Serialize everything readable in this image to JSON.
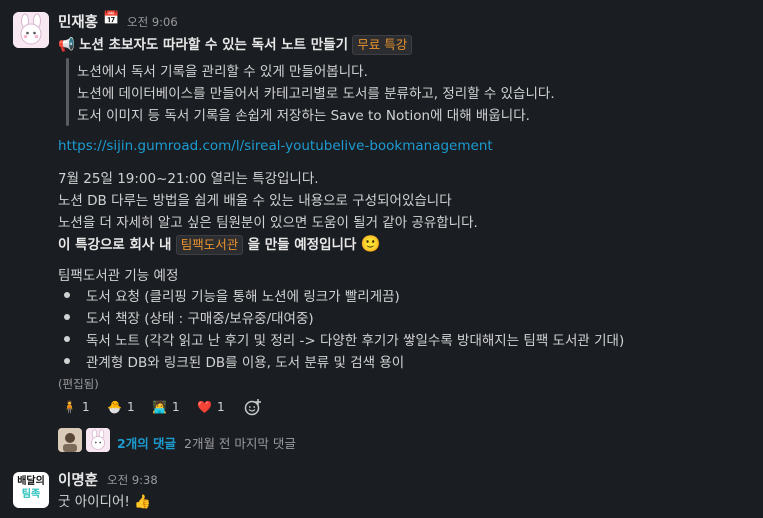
{
  "message1": {
    "author": "민재홍",
    "status_emoji": "📅",
    "time": "오전 9:06",
    "headline_emoji": "📢",
    "headline": "노션 초보자도 따라할 수 있는 독서 노트 만들기",
    "headline_tag": "무료 특강",
    "quote_lines": [
      "노션에서 독서 기록을 관리할 수 있게 만들어봅니다.",
      "노션에 데이터베이스를 만들어서 카테고리별로 도서를 분류하고, 정리할 수 있습니다.",
      "도서 이미지 등 독서 기록을 손쉽게 저장하는 Save to Notion에 대해 배웁니다."
    ],
    "link": "https://sijin.gumroad.com/l/sireal-youtubelive-bookmanagement",
    "para_lines": [
      "7월 25일 19:00~21:00 열리는 특강입니다.",
      "노션 DB 다루는 방법을 쉽게 배울 수 있는 내용으로 구성되어있습니다",
      "노션을 더 자세히 알고 싶은 팀원분이 있으면 도움이 될거 같아 공유합니다."
    ],
    "plan_prefix": "이 특강으로 회사 내",
    "plan_tag": "팀팩도서관",
    "plan_suffix": "을 만들 예정입니다",
    "plan_emoji": "🙂",
    "list_title": "팀팩도서관 기능 예정",
    "bullets": [
      "도서 요청 (클리핑 기능을 통해 노션에 링크가 빨리게끔)",
      "도서 책장 (상태 : 구매중/보유중/대여중)",
      "독서 노트 (각각 읽고 난 후기 및 정리 -> 다양한 후기가 쌓일수록 방대해지는 팀팩 도서관 기대)",
      "관계형 DB와 링크된 DB를 이용, 도서 분류 및 검색 용이"
    ],
    "edited": "(편집됨)",
    "reactions": [
      {
        "emoji": "🧍",
        "count": "1"
      },
      {
        "emoji": "🐣",
        "count": "1"
      },
      {
        "emoji": "🧑‍💻",
        "count": "1"
      },
      {
        "emoji": "❤️",
        "count": "1"
      }
    ],
    "thread_count": "2개의 댓글",
    "thread_last": "2개월 전 마지막 댓글"
  },
  "message2": {
    "author": "이명훈",
    "time": "오전 9:38",
    "avatar_text_1": "배달의",
    "avatar_text_2": "팀족",
    "text": "굿 아이디어!",
    "emoji": "👍"
  },
  "colors": {
    "background": "#1a1d21",
    "link": "#1d9bd1",
    "tag_text": "#e8912d",
    "reaction_highlight": "#2b2d31"
  }
}
